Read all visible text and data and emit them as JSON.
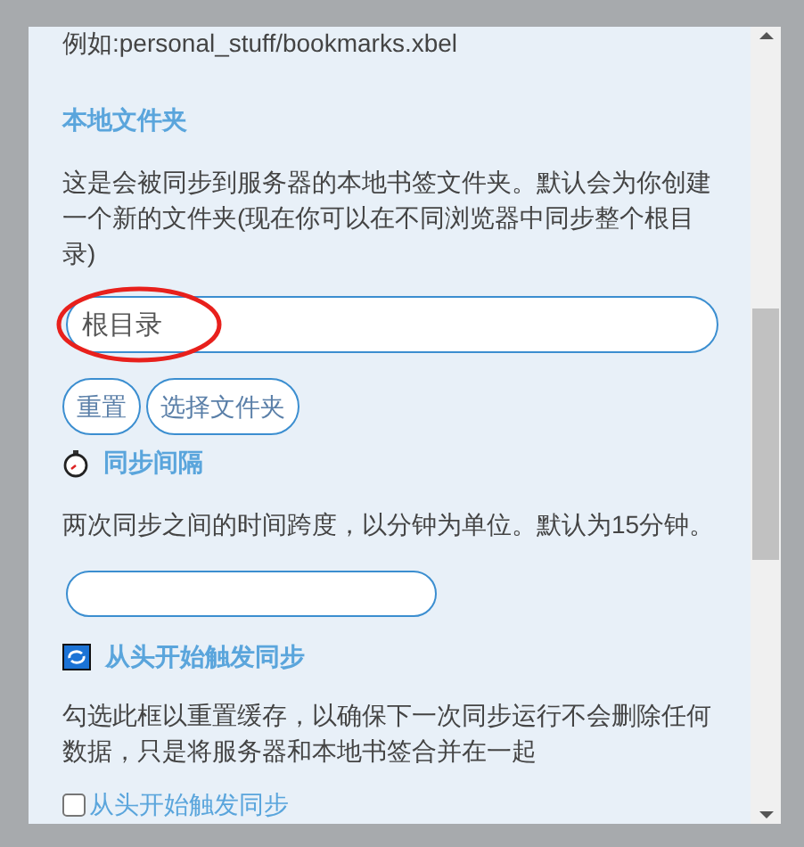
{
  "example_hint": "例如:personal_stuff/bookmarks.xbel",
  "local_folder": {
    "heading": "本地文件夹",
    "description": "这是会被同步到服务器的本地书签文件夹。默认会为你创建一个新的文件夹(现在你可以在不同浏览器中同步整个根目录)",
    "field": {
      "placeholder": "根目录",
      "highlighted": true
    },
    "buttons": [
      "重置",
      "选择文件夹"
    ]
  },
  "sync_interval": {
    "heading": "同步间隔",
    "description": "两次同步之间的时间跨度，以分钟为单位。默认为15分钟。"
  },
  "reset_sync": {
    "heading": "从头开始触发同步",
    "description": "勾选此框以重置缓存，以确保下一次同步运行不会删除任何数据，只是将服务器和本地书签合并在一起",
    "checkbox": {
      "label": "从头开始触发同步",
      "checked": false
    }
  }
}
